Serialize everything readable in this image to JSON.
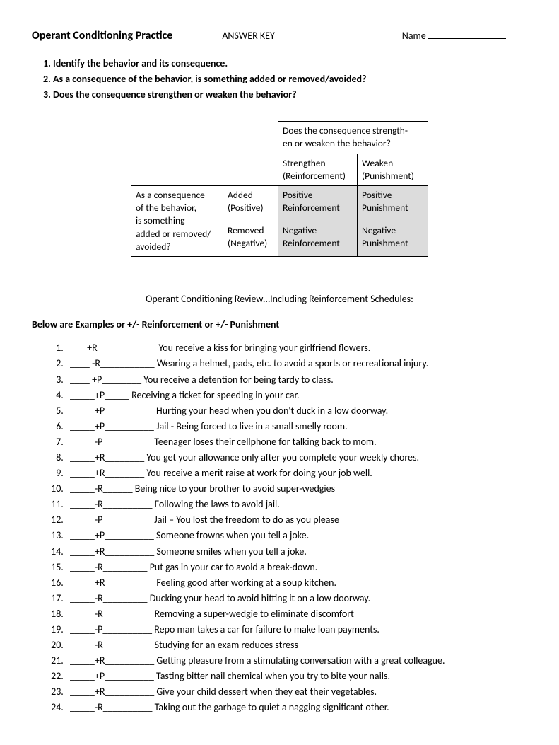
{
  "header": {
    "title": "Operant Conditioning Practice",
    "answer_key": "ANSWER KEY",
    "name_label": "Name"
  },
  "instructions": [
    "Identify the behavior and its consequence.",
    "As a consequence of the behavior, is something added or removed/avoided?",
    "Does the consequence strengthen or weaken the behavior?"
  ],
  "table": {
    "top_header": "Does the consequence strength-\nen or weaken the behavior?",
    "col1": "Strengthen\n(Reinforcement)",
    "col2": "Weaken\n(Punishment)",
    "row_header": "As a consequence\nof the behavior,\nis something\nadded or removed/\navoided?",
    "r1_label": "Added\n(Positive)",
    "r2_label": "Removed\n(Negative)",
    "c1r1": "Positive\nReinforcement",
    "c2r1": "Positive\nPunishment",
    "c1r2": "Negative\nReinforcement",
    "c2r2": "Negative\nPunishment"
  },
  "subheading": "Operant Conditioning Review…Including Reinforcement Schedules:",
  "section_title": "Below are Examples or +/- Reinforcement or +/- Punishment",
  "examples": [
    {
      "pre": "___    ",
      "code": "+R",
      "line": "____________",
      "text": " You receive a kiss for bringing your girlfriend flowers."
    },
    {
      "pre": "____  ",
      "code": "-R",
      "line": "___________",
      "text": " Wearing a helmet, pads, etc. to avoid a sports or recreational injury."
    },
    {
      "pre": "____  ",
      "code": "+P",
      "line": "________",
      "text": " You receive a detention for being tardy to class."
    },
    {
      "pre": "_____",
      "code": "+P",
      "line": "_____",
      "text": " Receiving a ticket for speeding in your car."
    },
    {
      "pre": "_____",
      "code": "+P",
      "line": "__________",
      "text": " Hurting your head when you don't duck in a low doorway."
    },
    {
      "pre": "_____",
      "code": "+P",
      "line": "__________",
      "text": " Jail - Being forced to live in a small smelly room."
    },
    {
      "pre": "_____",
      "code": "-P",
      "line": "__________",
      "text": " Teenager loses their cellphone for talking back to mom."
    },
    {
      "pre": "_____",
      "code": "+R",
      "line": "________",
      "text": " You get your allowance only after you complete your weekly chores."
    },
    {
      "pre": "_____",
      "code": "+R",
      "line": "________",
      "text": " You receive a merit raise at work for doing your job well."
    },
    {
      "pre": "_____",
      "code": "-R",
      "line": "______",
      "text": " Being nice to your brother to avoid super-wedgies"
    },
    {
      "pre": "_____",
      "code": "-R",
      "line": "__________",
      "text": " Following the laws to avoid jail."
    },
    {
      "pre": "_____",
      "code": "-P",
      "line": "__________",
      "text": " Jail – You lost the freedom to do as you please"
    },
    {
      "pre": "_____",
      "code": "+P",
      "line": "__________",
      "text": " Someone frowns when you tell a joke."
    },
    {
      "pre": "_____",
      "code": "+R",
      "line": "__________",
      "text": " Someone smiles when you tell a joke."
    },
    {
      "pre": "_____",
      "code": "-R",
      "line": "_________",
      "text": " Put gas in your car to avoid a break-down."
    },
    {
      "pre": "_____",
      "code": "+R",
      "line": "__________",
      "text": " Feeling good after working at a soup kitchen."
    },
    {
      "pre": "_____",
      "code": "-R",
      "line": "_________",
      "text": " Ducking your head to avoid hitting it on a low doorway."
    },
    {
      "pre": "_____",
      "code": "-R",
      "line": "__________",
      "text": " Removing a super-wedgie to eliminate discomfort"
    },
    {
      "pre": "_____",
      "code": "-P",
      "line": "__________",
      "text": " Repo man takes a car for failure to make loan payments."
    },
    {
      "pre": "_____",
      "code": "-R",
      "line": "__________",
      "text": " Studying for an exam reduces stress"
    },
    {
      "pre": "_____",
      "code": "+R",
      "line": "__________",
      "text": " Getting pleasure from a stimulating conversation with a great colleague."
    },
    {
      "pre": "_____",
      "code": "+P",
      "line": "__________",
      "text": " Tasting bitter nail chemical when you try to bite your nails."
    },
    {
      "pre": "_____",
      "code": "+R",
      "line": "__________",
      "text": " Give your child dessert when they eat their vegetables."
    },
    {
      "pre": "_____",
      "code": "-R",
      "line": "__________",
      "text": " Taking out the garbage to quiet a nagging significant other."
    }
  ]
}
